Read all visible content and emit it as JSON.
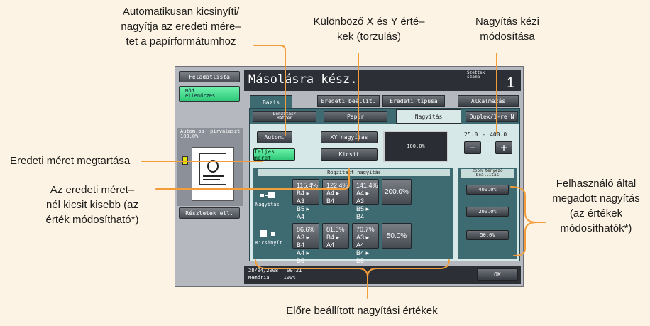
{
  "annotations": {
    "auto_lines": [
      "Automatikusan kicsinyíti/",
      "nagyítja az eredeti mére–",
      "tet a papírformátumhoz"
    ],
    "xy_lines": [
      "Különböző X és Y érté–",
      "kek (torzulás)"
    ],
    "manual_lines": [
      "Nagyítás kézi",
      "módosítása"
    ],
    "keep_size": "Eredeti méret megtartása",
    "smaller_lines": [
      "Az eredeti méret–",
      "nél kicsit kisebb (az",
      "érték módosítható*)"
    ],
    "user_zoom_lines": [
      "Felhasználó által",
      "megadott nagyítás",
      "(az értékek",
      "módosíthatók*)"
    ],
    "preset_caption": "Előre beállított nagyítási értékek"
  },
  "screen": {
    "side_buttons": {
      "job_list": "Feladatlista",
      "check_job": "Mód ellenőrzés",
      "details": "Részletek ell."
    },
    "thumb_info": "Autom.pa- pírválaszt 100.0%",
    "title": "Másolásra kész.",
    "copies_label": "Szettek száma",
    "copies_value": "1",
    "main_tabs": [
      "Bázis",
      "Eredeti beállít.",
      "Eredeti típusa",
      "Alkalmazás"
    ],
    "sub_tabs": [
      "Denzitás/ Háttér",
      "Papír",
      "Nagyítás",
      "Duplex/1-re N"
    ],
    "buttons": {
      "auto": "Autom.",
      "xy": "XY nagyítás",
      "full": "Teljes méret",
      "minimal": "Kicsit"
    },
    "zoom_display": "100.0%",
    "range_min": "25.0",
    "range_sep": "-",
    "range_max": "400.0",
    "minus": "−",
    "plus": "+",
    "fixed_title": "Rögzített nagyítás",
    "enlarge_label": "Nagyítás",
    "reduce_label": "Kicsinyít",
    "enlarge_presets": [
      {
        "pct": "115.4%",
        "l1": "B4 ▸ A3",
        "l2": "B5 ▸ A4"
      },
      {
        "pct": "122.4%",
        "l1": "",
        "l2": "A4 ▸ B4"
      },
      {
        "pct": "141.4%",
        "l1": "A4 ▸ A3",
        "l2": "B5 ▸ B4"
      }
    ],
    "enlarge_extra": "200.0%",
    "reduce_presets": [
      {
        "pct": "86.6%",
        "l1": "A3 ▸ B4",
        "l2": "A4 ▸ B5"
      },
      {
        "pct": "81.6%",
        "l1": "",
        "l2": "B4 ▸ A4"
      },
      {
        "pct": "70.7%",
        "l1": "A3 ▸ A4",
        "l2": "B4 ▸ B5"
      }
    ],
    "reduce_extra": "50.0%",
    "zoom_setting_title": "Zoom tényező beállítás",
    "zoom_settings": [
      "400.0%",
      "200.0%",
      "50.0%"
    ],
    "date": "28/04/2008",
    "time": "09:21",
    "memory_label": "Memória",
    "memory_value": "100%",
    "ok": "OK"
  },
  "colors": {
    "leader": "#f39c3a",
    "title_bar": "#2c2f36",
    "panel_teal": "#3e6b72",
    "active_green": "#3ad88a",
    "background": "#fdf3e4"
  }
}
